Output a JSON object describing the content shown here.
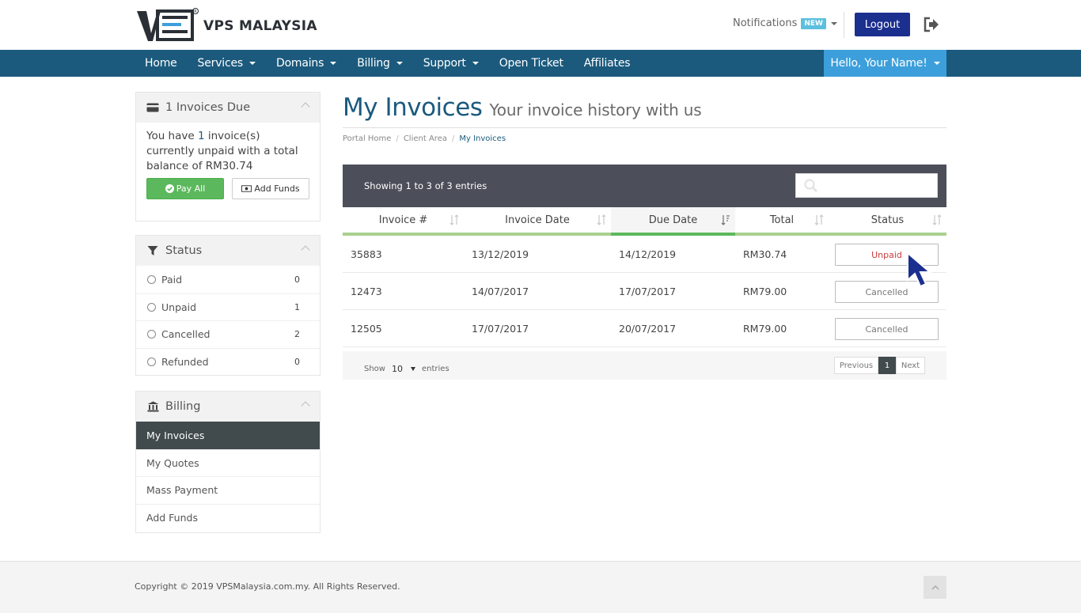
{
  "brand": {
    "name": "VPS MALAYSIA"
  },
  "header": {
    "notifications_label": "Notifications",
    "new_badge": "NEW",
    "logout_label": "Logout"
  },
  "nav": {
    "items": [
      {
        "label": "Home",
        "dropdown": false
      },
      {
        "label": "Services",
        "dropdown": true
      },
      {
        "label": "Domains",
        "dropdown": true
      },
      {
        "label": "Billing",
        "dropdown": true
      },
      {
        "label": "Support",
        "dropdown": true
      },
      {
        "label": "Open Ticket",
        "dropdown": false
      },
      {
        "label": "Affiliates",
        "dropdown": false
      }
    ],
    "account_label": "Hello, Your Name!"
  },
  "sidebar": {
    "due_panel": {
      "title": "1 Invoices Due",
      "text_before": "You have ",
      "count": "1",
      "text_after": " invoice(s) currently unpaid with a total balance of ",
      "balance": "RM30.74",
      "pay_all_label": "Pay All",
      "add_funds_label": "Add Funds"
    },
    "status_panel": {
      "title": "Status",
      "items": [
        {
          "label": "Paid",
          "count": "0"
        },
        {
          "label": "Unpaid",
          "count": "1"
        },
        {
          "label": "Cancelled",
          "count": "2"
        },
        {
          "label": "Refunded",
          "count": "0"
        }
      ]
    },
    "billing_panel": {
      "title": "Billing",
      "items": [
        {
          "label": "My Invoices",
          "active": true
        },
        {
          "label": "My Quotes",
          "active": false
        },
        {
          "label": "Mass Payment",
          "active": false
        },
        {
          "label": "Add Funds",
          "active": false
        }
      ]
    }
  },
  "main": {
    "title": "My Invoices",
    "subtitle": "Your invoice history with us",
    "breadcrumb": [
      "Portal Home",
      "Client Area",
      "My Invoices"
    ],
    "table": {
      "info": "Showing 1 to 3 of 3 entries",
      "search_value": "",
      "columns": [
        "Invoice #",
        "Invoice Date",
        "Due Date",
        "Total",
        "Status"
      ],
      "sorted_column": "Due Date",
      "rows": [
        {
          "invoice": "35883",
          "invoice_date": "13/12/2019",
          "due_date": "14/12/2019",
          "total": "RM30.74",
          "status": "Unpaid"
        },
        {
          "invoice": "12473",
          "invoice_date": "14/07/2017",
          "due_date": "17/07/2017",
          "total": "RM79.00",
          "status": "Cancelled"
        },
        {
          "invoice": "12505",
          "invoice_date": "17/07/2017",
          "due_date": "20/07/2017",
          "total": "RM79.00",
          "status": "Cancelled"
        }
      ],
      "footer": {
        "show_label": "Show",
        "page_length": "10",
        "entries_label": "entries",
        "previous_label": "Previous",
        "current_page": "1",
        "next_label": "Next"
      }
    }
  },
  "footer": {
    "copyright": "Copyright © 2019 VPSMalaysia.com.my. All Rights Reserved."
  },
  "colors": {
    "primary": "#1b5a7d",
    "logout_button": "#1b2f8f",
    "account_menu": "#3c9fdb",
    "success": "#5cb85c",
    "unpaid": "#cc3c3c",
    "table_header_bar": "#4c4f59",
    "active_sidebar": "#414a4c"
  }
}
